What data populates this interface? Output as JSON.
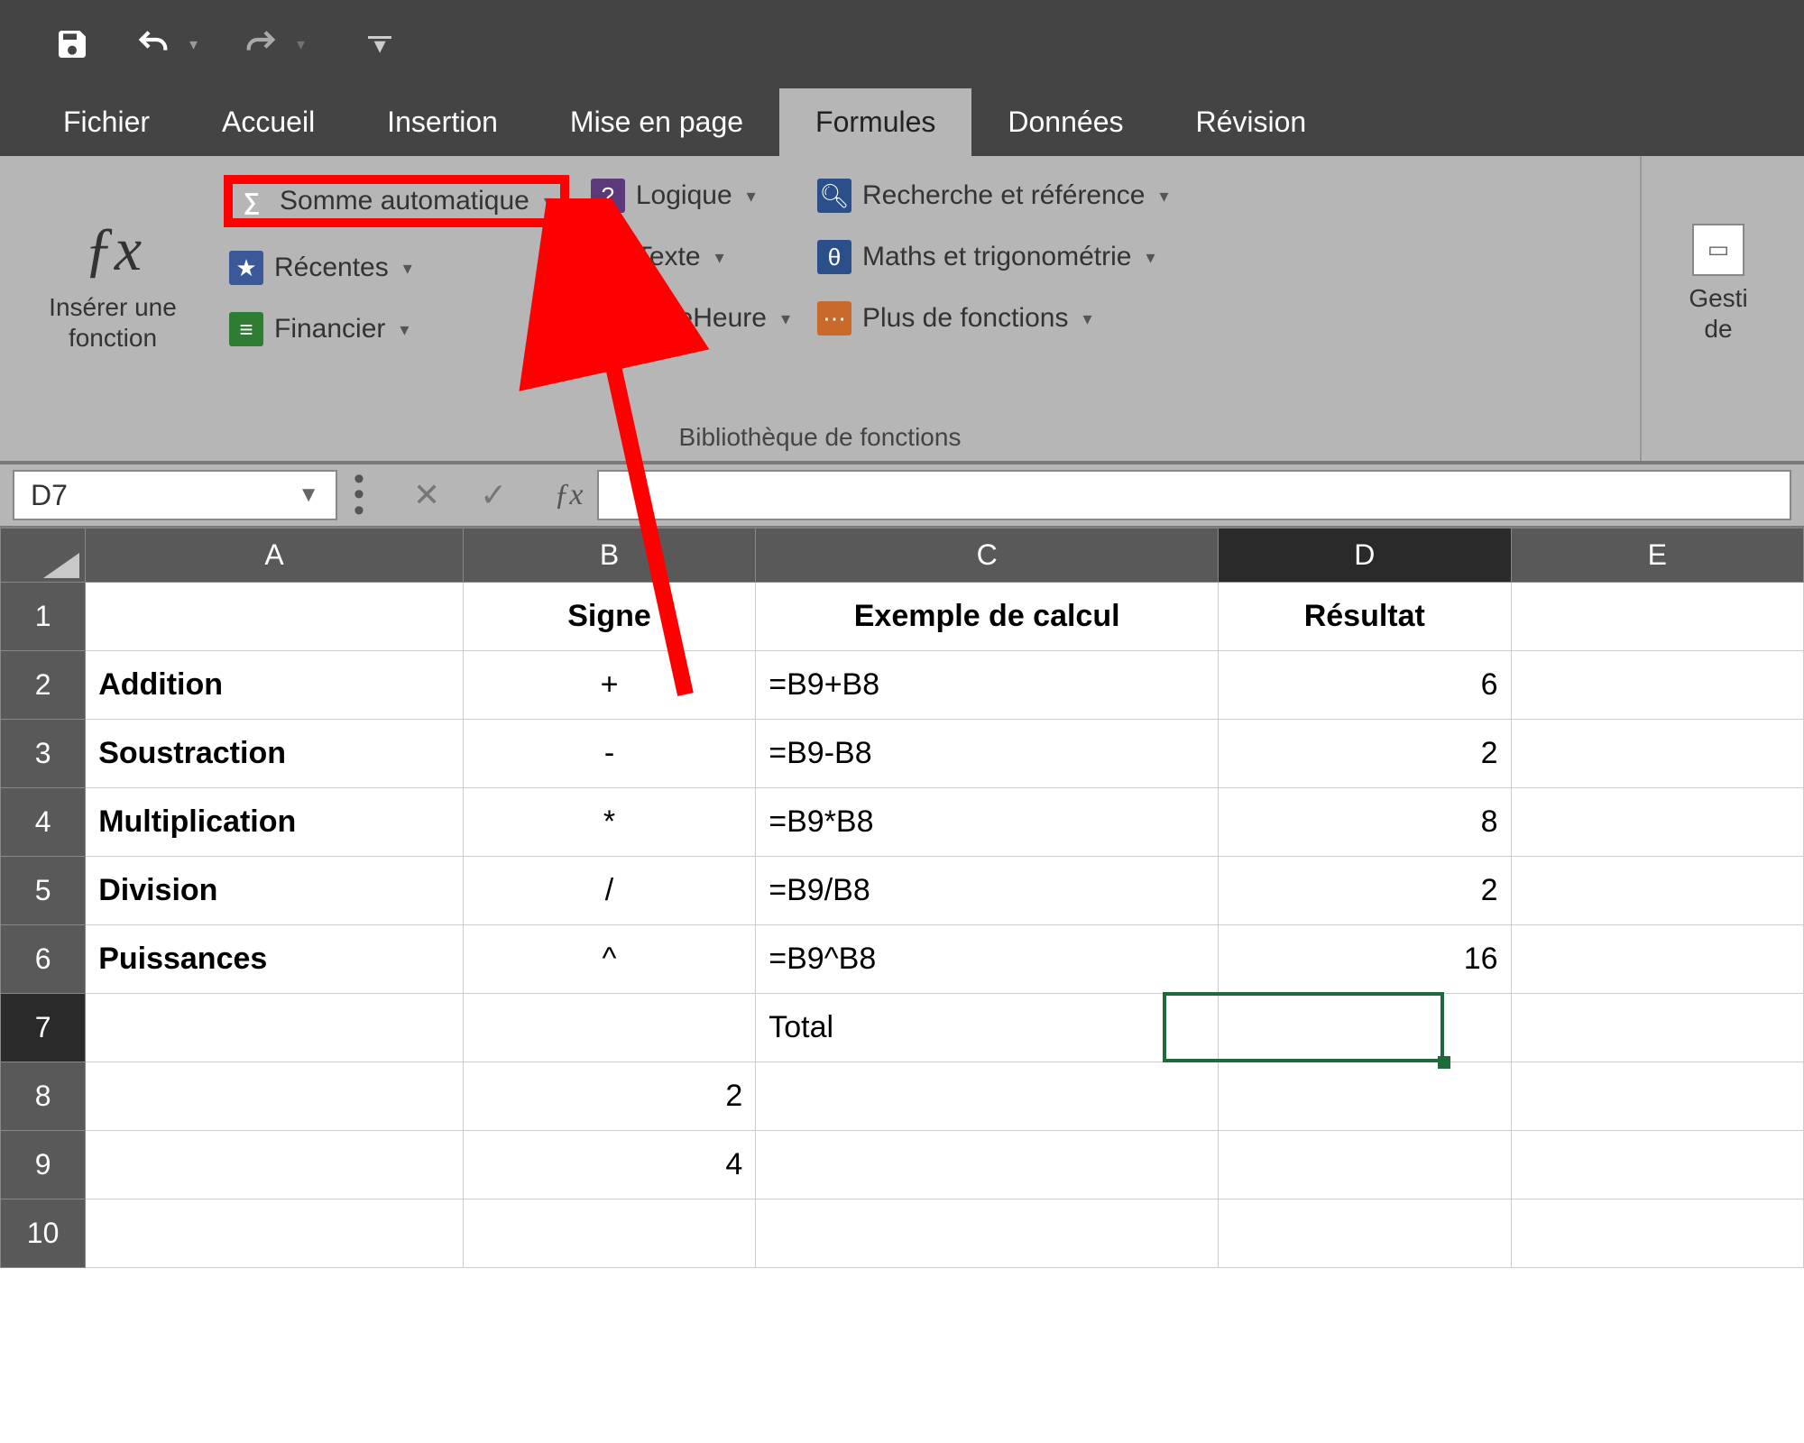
{
  "qat": {
    "save_title": "Enregistrer",
    "undo_title": "Annuler",
    "redo_title": "Rétablir"
  },
  "tabs": {
    "file": "Fichier",
    "home": "Accueil",
    "insert": "Insertion",
    "layout": "Mise en page",
    "formulas": "Formules",
    "data": "Données",
    "review": "Révision"
  },
  "ribbon": {
    "insert_fn": "Insérer une fonction",
    "autosum": "Somme automatique",
    "recent": "Récentes",
    "financial": "Financier",
    "logical": "Logique",
    "text": "Texte",
    "datetime": "DateHeure",
    "lookup": "Recherche et référence",
    "math": "Maths et trigonométrie",
    "more": "Plus de fonctions",
    "group_lib": "Bibliothèque de fonctions",
    "name_mgr_1": "Gesti",
    "name_mgr_2": "de"
  },
  "formula_bar": {
    "namebox": "D7",
    "formula": ""
  },
  "headers": {
    "A": "A",
    "B": "B",
    "C": "C",
    "D": "D",
    "E": "E"
  },
  "rows": {
    "r1": {
      "n": "1",
      "B": "Signe",
      "C": "Exemple de calcul",
      "D": "Résultat"
    },
    "r2": {
      "n": "2",
      "A": "Addition",
      "B": "+",
      "C": "=B9+B8",
      "D": "6"
    },
    "r3": {
      "n": "3",
      "A": "Soustraction",
      "B": "-",
      "C": "=B9-B8",
      "D": "2"
    },
    "r4": {
      "n": "4",
      "A": "Multiplication",
      "B": "*",
      "C": "=B9*B8",
      "D": "8"
    },
    "r5": {
      "n": "5",
      "A": "Division",
      "B": "/",
      "C": "=B9/B8",
      "D": "2"
    },
    "r6": {
      "n": "6",
      "A": "Puissances",
      "B": "^",
      "C": "=B9^B8",
      "D": "16"
    },
    "r7": {
      "n": "7",
      "C": "Total"
    },
    "r8": {
      "n": "8",
      "B": "2"
    },
    "r9": {
      "n": "9",
      "B": "4"
    },
    "r10": {
      "n": "10"
    }
  }
}
